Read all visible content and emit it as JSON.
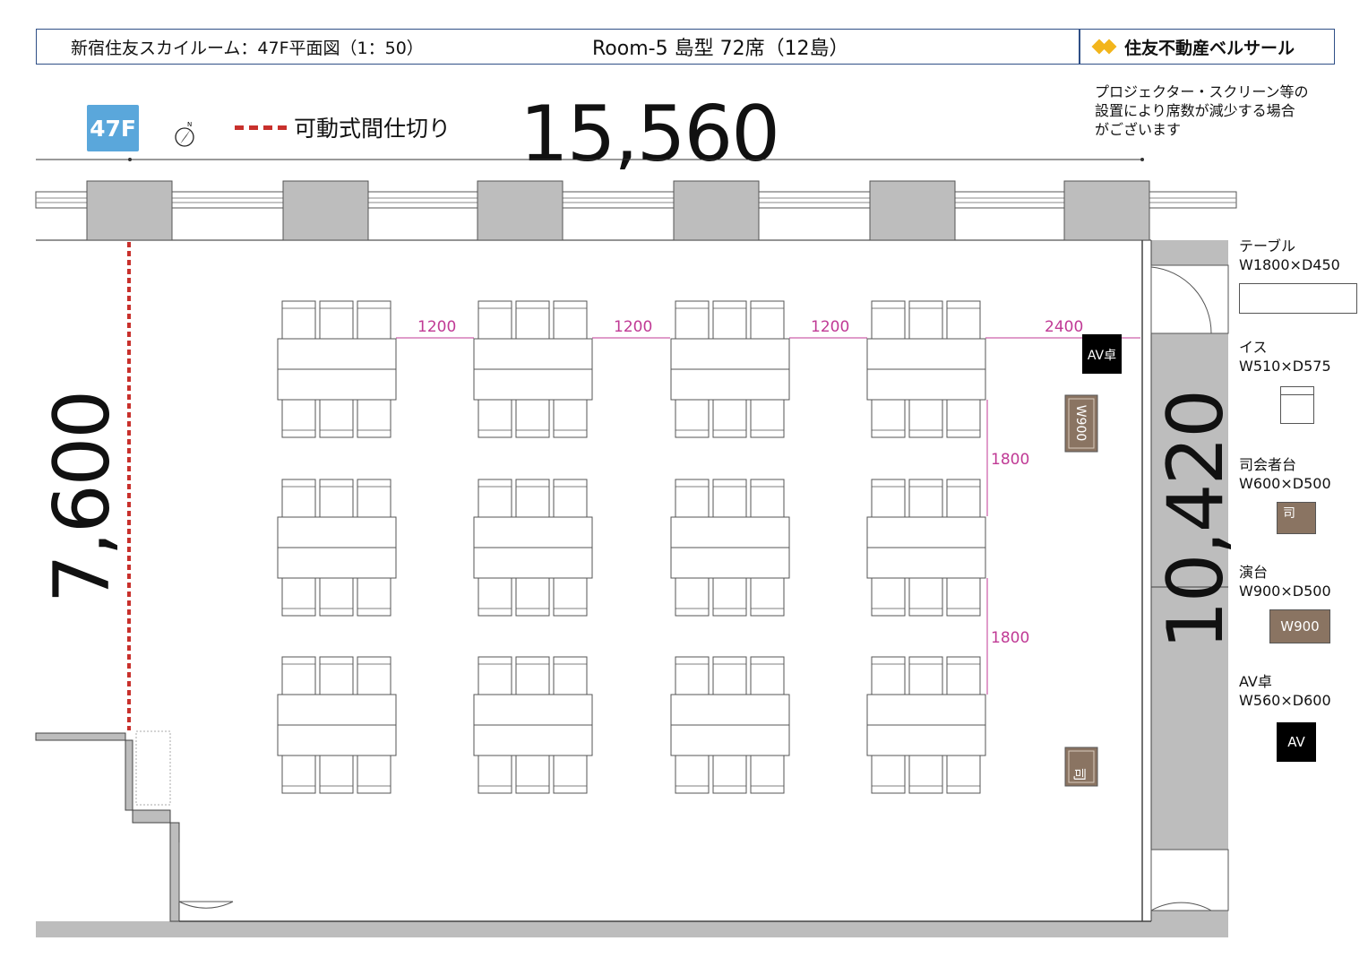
{
  "header": {
    "venue_title": "新宿住友スカイルーム：47F平面図（1：50）",
    "room_title": "Room-5 島型 72席（12島）",
    "brand": "住友不動産ベルサール"
  },
  "floor_badge": "47F",
  "partition_legend": "可動式間仕切り",
  "dimensions": {
    "top": "15,560",
    "left": "7,600",
    "right": "10,420",
    "gaps": [
      "1200",
      "1200",
      "1200",
      "2400"
    ],
    "rows": [
      "1800",
      "1800"
    ]
  },
  "note": {
    "line1": "プロジェクター・スクリーン等の",
    "line2": "設置により席数が減少する場合",
    "line3": "がございます"
  },
  "legend": {
    "table": {
      "name": "テーブル",
      "size": "W1800×D450"
    },
    "chair": {
      "name": "イス",
      "size": "W510×D575"
    },
    "mc": {
      "name": "司会者台",
      "size": "W600×D500",
      "mark": "司"
    },
    "podium": {
      "name": "演台",
      "size": "W900×D500",
      "mark": "W900"
    },
    "av": {
      "name": "AV卓",
      "size": "W560×D600",
      "mark": "AV"
    }
  },
  "plan_labels": {
    "av_desk": "AV卓",
    "podium": "W900",
    "mc": "司"
  },
  "layout": {
    "islands_rows": 3,
    "islands_cols": 4,
    "seats_per_island": 6,
    "total_seats": 72
  },
  "colors": {
    "partition": "#c8302c",
    "dimension_line": "#c03a95",
    "badge": "#5aa7db",
    "furniture_brown": "#8a7462",
    "wall_gray": "#bdbdbd",
    "frame_blue": "#2f4f86"
  }
}
